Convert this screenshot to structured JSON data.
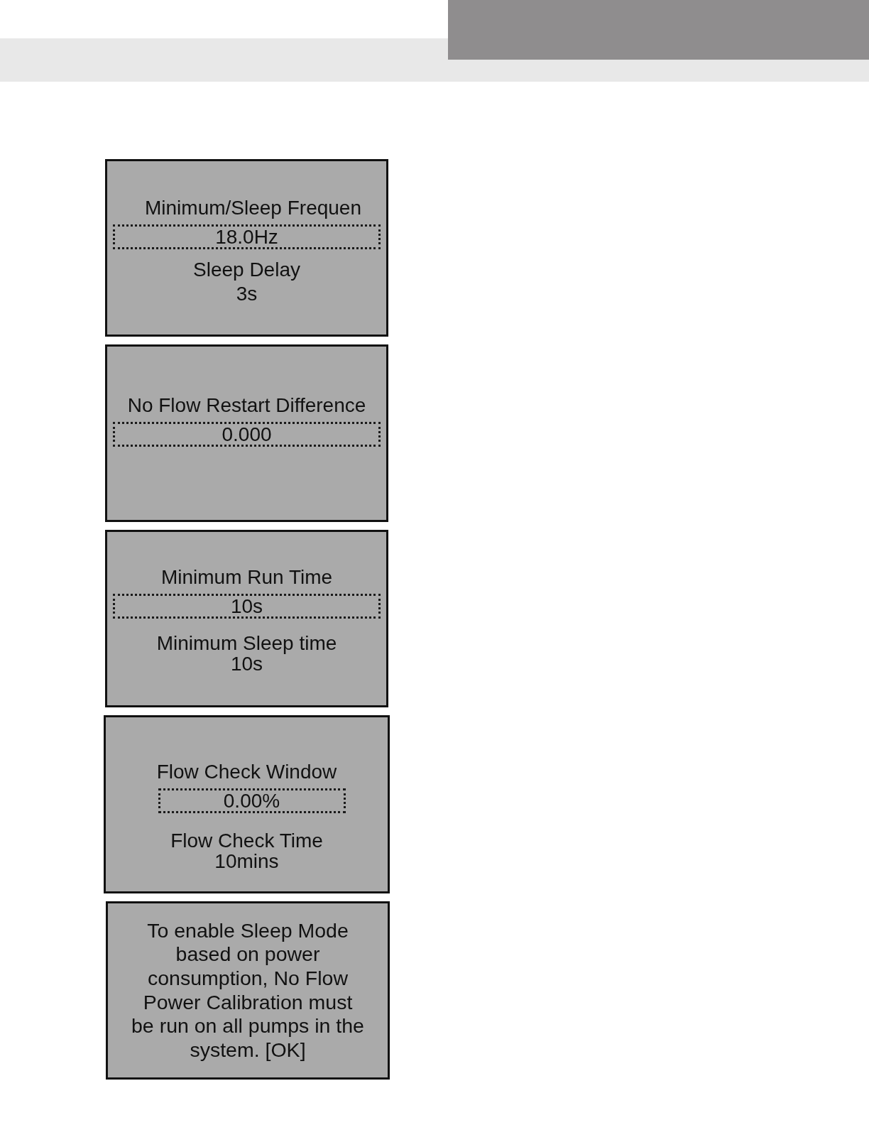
{
  "screens": [
    {
      "kind": "setting",
      "title": "Minimum/Sleep Frequen",
      "value": "18.0Hz",
      "secondary": {
        "label": "Sleep Delay",
        "value": "3s"
      }
    },
    {
      "kind": "setting",
      "title": "No Flow Restart Difference",
      "value": "0.000"
    },
    {
      "kind": "setting",
      "title": "Minimum Run Time",
      "value": "10s",
      "secondary": {
        "label": "Minimum Sleep time",
        "value": "10s"
      }
    },
    {
      "kind": "setting",
      "title": "Flow Check Window",
      "value": "0.00%",
      "secondary": {
        "label": "Flow Check Time",
        "value": "10mins"
      }
    },
    {
      "kind": "message",
      "text": "To enable Sleep Mode\nbased on power\nconsumption, No Flow\nPower Calibration must\nbe run on all pumps in the\nsystem. [OK]"
    }
  ]
}
